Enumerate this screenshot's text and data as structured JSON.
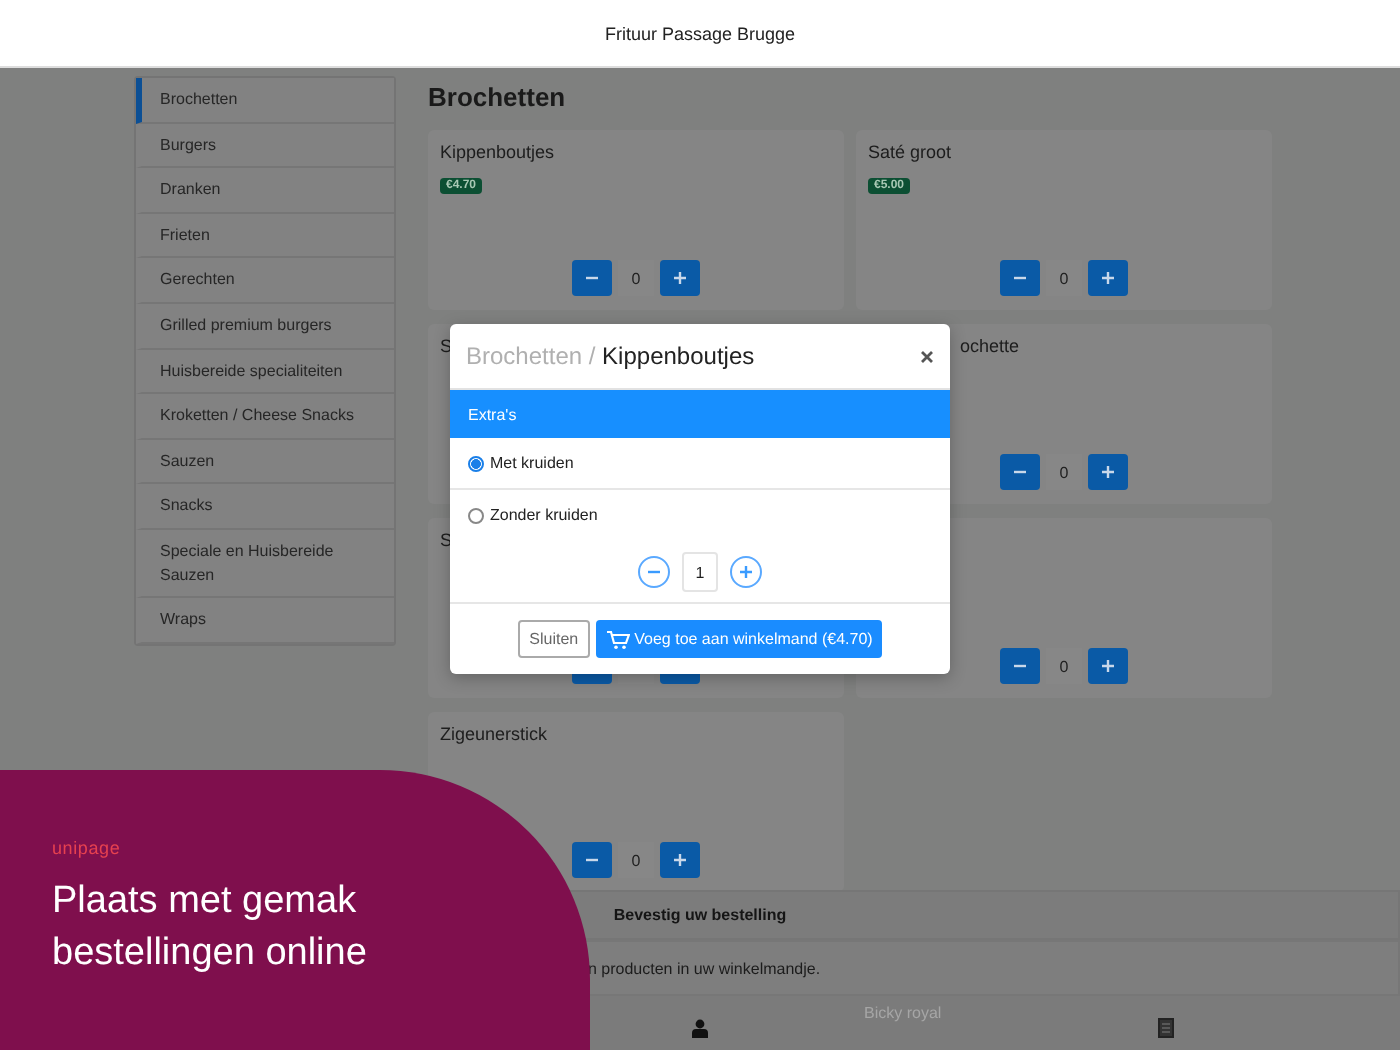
{
  "header": {
    "title": "Frituur Passage Brugge"
  },
  "sidebar": {
    "items": [
      {
        "label": "Brochetten",
        "selected": true
      },
      {
        "label": "Burgers",
        "selected": false
      },
      {
        "label": "Dranken",
        "selected": false
      },
      {
        "label": "Frieten",
        "selected": false
      },
      {
        "label": "Gerechten",
        "selected": false
      },
      {
        "label": "Grilled premium burgers",
        "selected": false
      },
      {
        "label": "Huisbereide specialiteiten",
        "selected": false
      },
      {
        "label": "Kroketten / Cheese Snacks",
        "selected": false
      },
      {
        "label": "Sauzen",
        "selected": false
      },
      {
        "label": "Snacks",
        "selected": false
      },
      {
        "label": "Speciale en Huisbereide Sauzen",
        "selected": false
      },
      {
        "label": "Wraps",
        "selected": false
      }
    ]
  },
  "content": {
    "heading": "Brochetten",
    "products": [
      {
        "name": "Kippenboutjes",
        "price": "€4.70",
        "count": "0"
      },
      {
        "name": "Saté groot",
        "price": "€5.00",
        "count": "0"
      },
      {
        "name": "S"
      },
      {
        "name": "ochette",
        "count": "0"
      },
      {
        "name": "S"
      },
      {
        "count": "0"
      },
      {
        "name": "Zigeunerstick",
        "count": "0"
      }
    ]
  },
  "dialog": {
    "breadcrumb": "Brochetten /",
    "title": "Kippenboutjes",
    "section": "Extra's",
    "options": [
      {
        "label": "Met kruiden",
        "selected": true
      },
      {
        "label": "Zonder kruiden",
        "selected": false
      }
    ],
    "quantity": "1",
    "buttons": [
      {
        "kind": "secondary",
        "label": "Sluiten"
      },
      {
        "kind": "primary",
        "label": "Voeg toe aan winkelmand (€4.70)"
      }
    ]
  },
  "order_panel": {
    "title": "Bevestig uw bestelling",
    "message": "n producten in uw winkelmandje.",
    "background_item": "Bicky royal"
  },
  "promo": {
    "logo": "unipage",
    "headline": "Plaats met gemak bestellingen online"
  }
}
